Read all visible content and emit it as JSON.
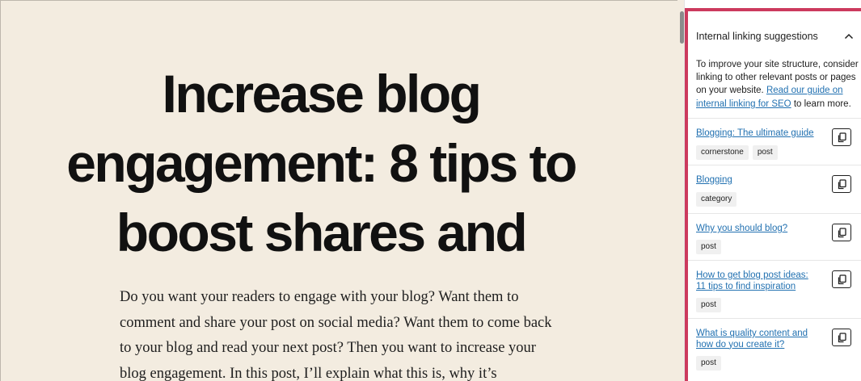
{
  "post": {
    "title": "Increase blog engagement: 8 tips to boost shares and",
    "body": "Do you want your readers to engage with your blog? Want them to comment and share your post on social media? Want them to come back to your blog and read your next post? Then you want to increase your blog engagement. In this post, I’ll explain what this is, why it’s"
  },
  "sidebar": {
    "panel_title": "Internal linking suggestions",
    "intro_before": "To improve your site structure, consider linking to other relevant posts or pages on your website. ",
    "intro_link": "Read our guide on internal linking for SEO",
    "intro_after": " to learn more.",
    "icons": {
      "collapse": "chevron-up-icon",
      "copy": "copy-icon"
    },
    "suggestions": [
      {
        "title": "Blogging: The ultimate guide",
        "tags": [
          "cornerstone",
          "post"
        ]
      },
      {
        "title": "Blogging",
        "tags": [
          "category"
        ]
      },
      {
        "title": "Why you should blog?",
        "tags": [
          "post"
        ]
      },
      {
        "title": "How to get blog post ideas: 11 tips to find inspiration",
        "tags": [
          "post"
        ]
      },
      {
        "title": "What is quality content and how do you create it?",
        "tags": [
          "post"
        ]
      }
    ]
  },
  "colors": {
    "accent": "#cc3a5e",
    "link": "#2271b1",
    "canvas": "#f3ece0"
  }
}
